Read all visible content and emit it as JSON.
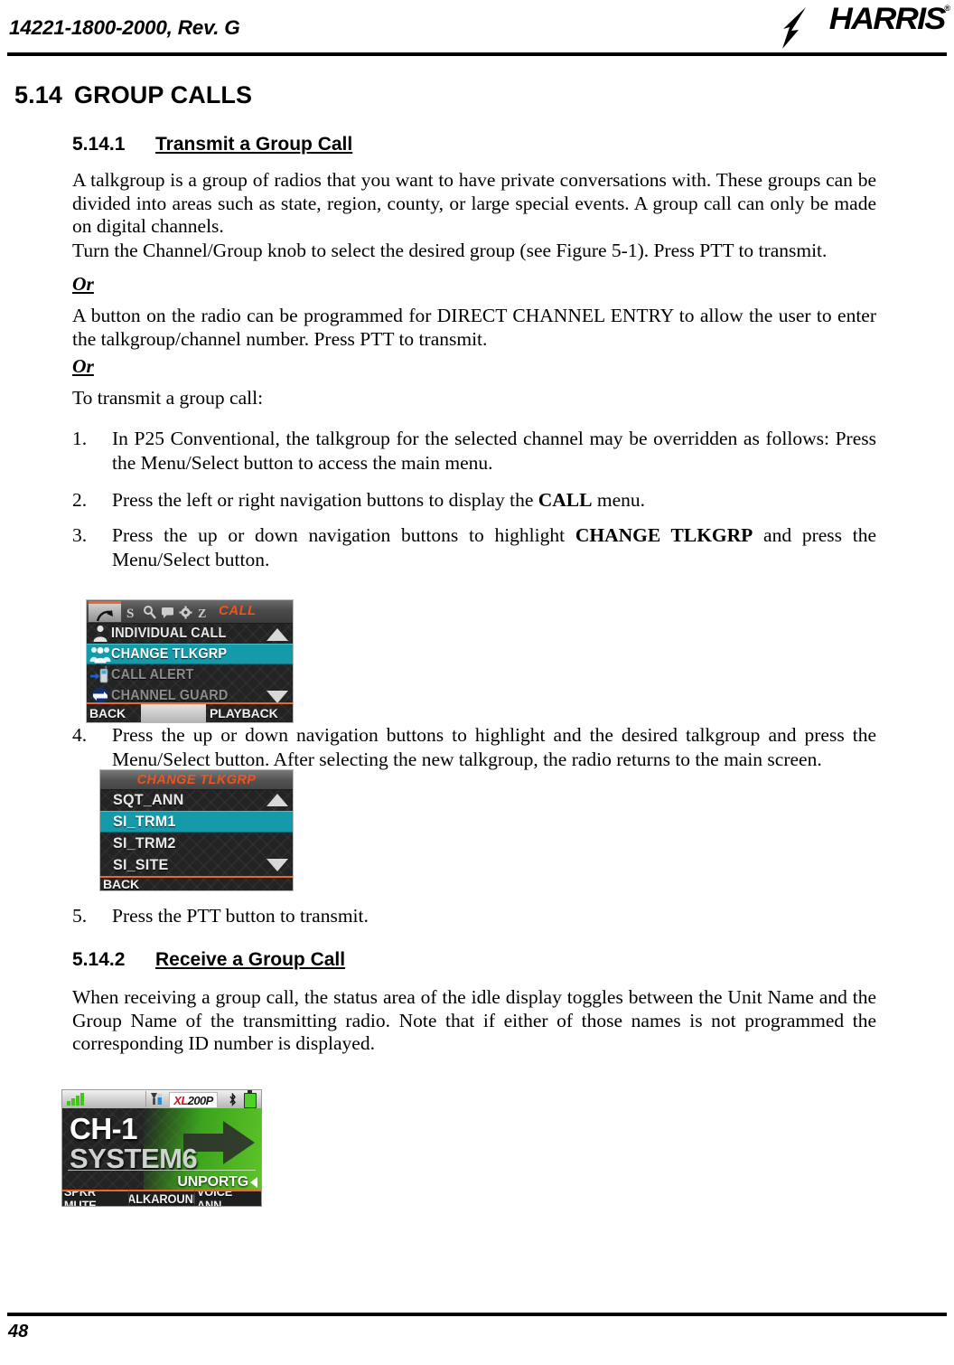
{
  "header": {
    "doc_number": "14221-1800-2000, Rev. G",
    "logo_text": "HARRIS",
    "logo_tm": "®"
  },
  "footer": {
    "page_number": "48"
  },
  "section": {
    "number": "5.14",
    "title": "GROUP CALLS"
  },
  "sub1": {
    "number": "5.14.1",
    "title": "Transmit a Group Call",
    "p1": "A talkgroup is a group of radios that you want to have private conversations with. These groups can be divided into areas such as state, region, county, or large special events. A group call can only be made on digital channels.",
    "p2": "Turn the Channel/Group knob to select the desired group (see Figure 5-1). Press PTT to transmit.",
    "or1": "Or",
    "p3": "A button on the radio can be programmed for DIRECT CHANNEL ENTRY to allow the user to enter the talkgroup/channel number. Press PTT to transmit.",
    "or2": "Or",
    "p4": "To transmit a group call:",
    "steps": [
      {
        "marker": "1.",
        "text_a": "In P25 Conventional, the talkgroup for the selected channel may be overridden as follows: Press the Menu/Select button to access the main menu."
      },
      {
        "marker": "2.",
        "text_a": "Press the left or right navigation buttons to display the ",
        "bold": "CALL",
        "text_b": " menu."
      },
      {
        "marker": "3.",
        "text_a": "Press the up or down navigation buttons to highlight ",
        "bold": "CHANGE TLKGRP",
        "text_b": " and press the Menu/Select button."
      },
      {
        "marker": "4.",
        "text_a": "Press the up or down navigation buttons to highlight and the desired talkgroup and press the Menu/Select button. After selecting the new talkgroup, the radio returns to the main screen."
      },
      {
        "marker": "5.",
        "text_a": "Press the PTT button to transmit."
      }
    ]
  },
  "sub2": {
    "number": "5.14.2",
    "title": "Receive a Group Call",
    "p1": "When receiving a group call, the status area of the idle display toggles between the Unit Name and the Group Name of the transmitting radio. Note that if either of those names is not programmed the corresponding ID number is displayed."
  },
  "screen_call_menu": {
    "tab_label": "CALL",
    "tab_icons": [
      "call-arrow-icon",
      "scan-s-icon",
      "search-icon",
      "message-icon",
      "gear-icon",
      "sleep-z-icon"
    ],
    "items": [
      {
        "label": "INDIVIDUAL CALL",
        "icon": "single-person-icon",
        "state": "normal"
      },
      {
        "label": "CHANGE TLKGRP",
        "icon": "group-people-icon",
        "state": "selected"
      },
      {
        "label": "CALL ALERT",
        "icon": "radio-alert-icon",
        "state": "dim"
      },
      {
        "label": "CHANNEL GUARD",
        "icon": "channel-guard-icon",
        "state": "dim"
      }
    ],
    "softkeys": [
      "BACK",
      "",
      "PLAYBACK"
    ],
    "accent_color": "#f0531d",
    "highlight_color": "#159aaa"
  },
  "screen_change_tlkgrp": {
    "title": "CHANGE TLKGRP",
    "items": [
      {
        "label": "SQT_ANN",
        "state": "normal"
      },
      {
        "label": "SI_TRM1",
        "state": "selected"
      },
      {
        "label": "SI_TRM2",
        "state": "normal"
      },
      {
        "label": "SI_SITE",
        "state": "normal"
      }
    ],
    "softkeys": [
      "BACK",
      ""
    ],
    "accent_color": "#f0531d",
    "highlight_color": "#159aaa"
  },
  "screen_idle": {
    "status_badge_xl": "XL",
    "status_badge_200p": "200P",
    "channel": "CH-1",
    "system": "SYSTEM6",
    "zone_label": "UNPORTG",
    "softkeys": [
      "SPKR MUTE",
      "TALKAROUND",
      "VOICE ANN."
    ],
    "accent_color": "#f0662a",
    "green_color": "#5ecb28"
  }
}
